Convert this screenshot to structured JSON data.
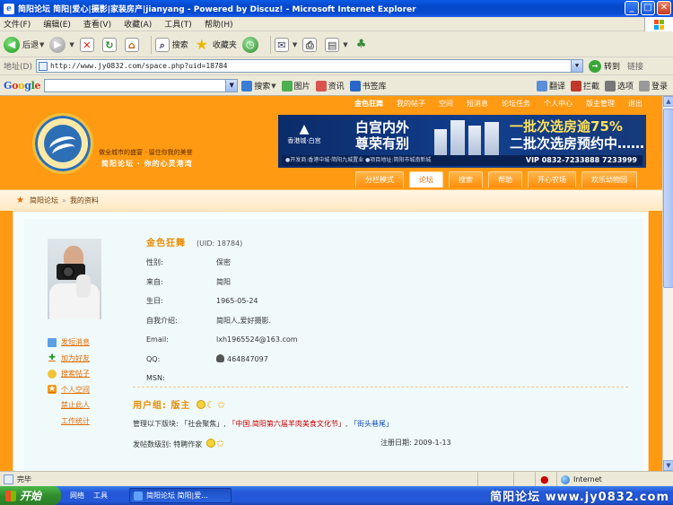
{
  "window": {
    "title": "简阳论坛 简阳|爱心|摄影|家装房产|jianyang - Powered by Discuz! - Microsoft Internet Explorer"
  },
  "menu": [
    "文件(F)",
    "编辑(E)",
    "查看(V)",
    "收藏(A)",
    "工具(T)",
    "帮助(H)"
  ],
  "toolbar": {
    "back": "后退",
    "search": "搜索",
    "favorites": "收藏夹"
  },
  "address": {
    "label": "地址(D)",
    "url": "http://www.jy0832.com/space.php?uid=18784",
    "go": "转到",
    "links": "链接"
  },
  "google": {
    "search_label": "搜索",
    "buttons": [
      "图片",
      "资讯",
      "书签库"
    ],
    "right": [
      "翻译",
      "拦截",
      "选项",
      "登录"
    ]
  },
  "site": {
    "topnav": [
      "金色狂舞",
      "我的帖子",
      "空间",
      "短消息",
      "论坛任务",
      "个人中心",
      "版主管理",
      "退出"
    ],
    "logo_text": "简阳论坛",
    "logo_url": "WWW.JY0832.COM",
    "slogan1": "做全城市的盛宴 · 留住你我的美誉",
    "slogan2": "简阳论坛 · 你的心灵港湾",
    "banner": {
      "brand": "香港城·白宫",
      "title1": "白宫内外",
      "title2": "尊荣有别",
      "promo1": "一批次选房逾",
      "promo1_pct": "75%",
      "promo2": "二批次选房预约中……",
      "foot": "●开发商:香港中城·简阳九城置业 ●项目地址:简阳市城南新城",
      "phone": "VIP 0832-7233888 7233999"
    },
    "tabs": [
      "分栏模式",
      "论坛",
      "搜索",
      "帮助",
      "开心农场",
      "欢乐幼物园"
    ],
    "active_tab": "论坛",
    "breadcrumb": [
      "简阳论坛",
      "我的资料"
    ]
  },
  "profile": {
    "name": "金色狂舞",
    "uid": "(UID: 18784)",
    "rows": [
      {
        "k": "性别:",
        "v": "保密"
      },
      {
        "k": "来自:",
        "v": "简阳"
      },
      {
        "k": "生日:",
        "v": "1965-05-24"
      },
      {
        "k": "自我介绍:",
        "v": "简阳人,爱好摄影."
      },
      {
        "k": "Email:",
        "v": "lxh1965524@163.com"
      },
      {
        "k": "QQ:",
        "v": "464847097"
      },
      {
        "k": "MSN:",
        "v": ""
      }
    ],
    "side_links": [
      "发短消息",
      "加为好友",
      "搜索帖子",
      "个人空间",
      "禁止此人",
      "工作统计"
    ],
    "group_label": "用户组: 版主",
    "mod_prefix": "管理以下版块: ",
    "mod_forums": [
      "「社会聚焦」",
      "「中国.简阳第六届羊肉美食文化节」",
      "「街头巷尾」"
    ],
    "level_label": "发帖数级别: 特聘作家",
    "reg_label": "注册日期: 2009-1-13"
  },
  "status": {
    "text": "完毕",
    "zone": "Internet"
  },
  "taskbar": {
    "start": "开始",
    "quick": [
      "网络",
      "工具"
    ],
    "task": "简阳论坛 简阳|爱...",
    "watermark": "简阳论坛 www.jy0832.com"
  }
}
